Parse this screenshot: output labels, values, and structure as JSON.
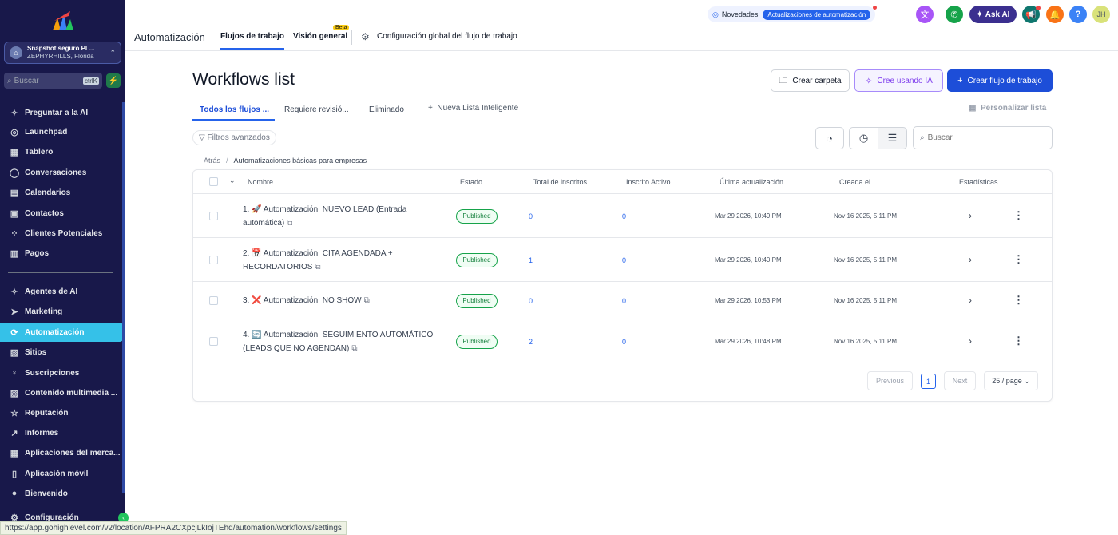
{
  "sidebar": {
    "location": {
      "name": "Snapshot seguro PL...",
      "sub": "ZEPHYRHILLS, Florida"
    },
    "search": {
      "placeholder": "Buscar",
      "shortcut": "ctrlK"
    },
    "items": [
      {
        "label": "Preguntar a la AI",
        "icon": "sparkle-icon"
      },
      {
        "label": "Launchpad",
        "icon": "rocket-icon"
      },
      {
        "label": "Tablero",
        "icon": "grid-icon"
      },
      {
        "label": "Conversaciones",
        "icon": "chat-icon"
      },
      {
        "label": "Calendarios",
        "icon": "calendar-icon"
      },
      {
        "label": "Contactos",
        "icon": "contacts-icon"
      },
      {
        "label": "Clientes Potenciales",
        "icon": "pipeline-icon"
      },
      {
        "label": "Pagos",
        "icon": "payments-icon"
      },
      {
        "label": "Agentes de AI",
        "icon": "sparkle-icon"
      },
      {
        "label": "Marketing",
        "icon": "send-icon"
      },
      {
        "label": "Automatización",
        "icon": "automation-icon"
      },
      {
        "label": "Sitios",
        "icon": "sites-icon"
      },
      {
        "label": "Suscripciones",
        "icon": "membership-icon"
      },
      {
        "label": "Contenido multimedia ...",
        "icon": "media-icon"
      },
      {
        "label": "Reputación",
        "icon": "star-icon"
      },
      {
        "label": "Informes",
        "icon": "chart-icon"
      },
      {
        "label": "Aplicaciones del merca...",
        "icon": "apps-icon"
      },
      {
        "label": "Aplicación móvil",
        "icon": "mobile-icon"
      },
      {
        "label": "Bienvenido",
        "icon": "info-icon"
      },
      {
        "label": "Configuración",
        "icon": "gear-icon"
      }
    ]
  },
  "header": {
    "title": "Automatización",
    "tabs": [
      "Flujos de trabajo",
      "Visión general"
    ],
    "beta": "Beta",
    "global_settings": "Configuración global del flujo de trabajo",
    "novedades": "Novedades",
    "novedades_pill": "Actualizaciones de automatización",
    "ask_ai": "Ask AI",
    "avatar": "JH"
  },
  "main": {
    "title": "Workflows list",
    "buttons": {
      "folder": "Crear carpeta",
      "ai": "Cree usando IA",
      "create": "Crear flujo de trabajo"
    },
    "subtabs": [
      "Todos los flujos ...",
      "Requiere revisió...",
      "Eliminado"
    ],
    "smart_list": "Nueva Lista Inteligente",
    "customize": "Personalizar lista",
    "filters": "Filtros avanzados",
    "search_placeholder": "Buscar",
    "breadcrumb": {
      "back": "Atrás",
      "current": "Automatizaciones básicas para empresas"
    }
  },
  "table": {
    "columns": [
      "Nombre",
      "Estado",
      "Total de inscritos",
      "Inscrito Activo",
      "Última actualización",
      "Creada el",
      "Estadísticas"
    ],
    "rows": [
      {
        "name": "1. 🚀 Automatización: NUEVO LEAD (Entrada automática)",
        "status": "Published",
        "total": "0",
        "active": "0",
        "updated": "Mar 29 2026, 10:49 PM",
        "created": "Nov 16 2025, 5:11 PM"
      },
      {
        "name": "2. 📅 Automatización: CITA AGENDADA + RECORDATORIOS",
        "status": "Published",
        "total": "1",
        "active": "0",
        "updated": "Mar 29 2026, 10:40 PM",
        "created": "Nov 16 2025, 5:11 PM"
      },
      {
        "name": "3. ❌ Automatización: NO SHOW",
        "status": "Published",
        "total": "0",
        "active": "0",
        "updated": "Mar 29 2026, 10:53 PM",
        "created": "Nov 16 2025, 5:11 PM"
      },
      {
        "name": "4. 🔄 Automatización: SEGUIMIENTO AUTOMÁTICO (LEADS QUE NO AGENDAN)",
        "status": "Published",
        "total": "2",
        "active": "0",
        "updated": "Mar 29 2026, 10:48 PM",
        "created": "Nov 16 2025, 5:11 PM"
      }
    ]
  },
  "pagination": {
    "previous": "Previous",
    "current": "1",
    "next": "Next",
    "per_page": "25 / page"
  },
  "status_url": "https://app.gohighlevel.com/v2/location/AFPRA2CXpcjLkIojTEhd/automation/workflows/settings",
  "colors": {
    "sidebar": "#18184a",
    "active": "#35c1e8",
    "primary": "#1d4ed8",
    "published": "#16a34a"
  }
}
